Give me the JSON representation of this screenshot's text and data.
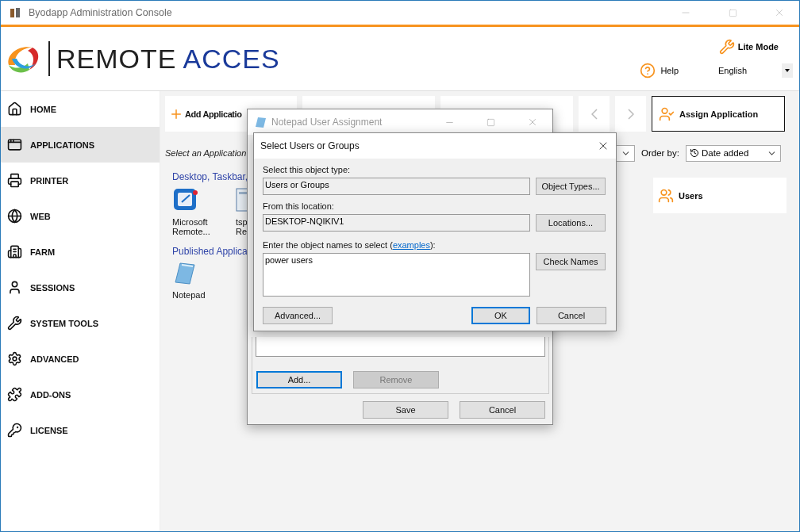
{
  "window": {
    "title": "Byodapp Administration Console"
  },
  "logo": {
    "primary": "REMOTE",
    "secondary": "ACCES"
  },
  "header": {
    "lite_mode": "Lite Mode",
    "help": "Help",
    "language": "English"
  },
  "sidebar": {
    "items": [
      {
        "label": "HOME",
        "selected": false
      },
      {
        "label": "APPLICATIONS",
        "selected": true
      },
      {
        "label": "PRINTER",
        "selected": false
      },
      {
        "label": "WEB",
        "selected": false
      },
      {
        "label": "FARM",
        "selected": false
      },
      {
        "label": "SESSIONS",
        "selected": false
      },
      {
        "label": "SYSTEM TOOLS",
        "selected": false
      },
      {
        "label": "ADVANCED",
        "selected": false
      },
      {
        "label": "ADD-ONS",
        "selected": false
      },
      {
        "label": "LICENSE",
        "selected": false
      }
    ]
  },
  "toolbar": {
    "add": "Add Applicatio",
    "assign": "Assign Application"
  },
  "filter": {
    "prompt": "Select an Application",
    "order_label": "Order by:",
    "order_value": "Date added"
  },
  "sections": [
    {
      "title": "Desktop, Taskbar,",
      "apps": [
        {
          "label": "Microsoft Remote...",
          "kind": "remote"
        },
        {
          "label": "tsp Re",
          "kind": "window"
        }
      ]
    },
    {
      "title": "Published Applica",
      "apps": [
        {
          "label": "Notepad",
          "kind": "notepad"
        }
      ]
    }
  ],
  "side_panel": {
    "users": "Users"
  },
  "assignment_dialog": {
    "title": "Notepad User Assignment",
    "list_buttons": [
      {
        "label": "Add...",
        "default": true,
        "disabled": false
      },
      {
        "label": "Remove",
        "default": false,
        "disabled": true
      }
    ],
    "buttons": [
      {
        "label": "Save",
        "default": false,
        "disabled": false
      },
      {
        "label": "Cancel",
        "default": false,
        "disabled": false
      }
    ]
  },
  "select_dialog": {
    "title": "Select Users or Groups",
    "type_label": "Select this object type:",
    "type_value": "Users or Groups",
    "type_button": "Object Types...",
    "location_label": "From this location:",
    "location_value": "DESKTOP-NQIKIV1",
    "location_button": "Locations...",
    "names_label": "Enter the object names to select (",
    "names_link": "examples",
    "names_label_end": "):",
    "names_value": "power users",
    "check_button": "Check Names",
    "buttons": [
      {
        "label": "Advanced...",
        "default": false,
        "disabled": false
      },
      {
        "label": "OK",
        "default": true,
        "disabled": false
      },
      {
        "label": "Cancel",
        "default": false,
        "disabled": false
      }
    ]
  }
}
